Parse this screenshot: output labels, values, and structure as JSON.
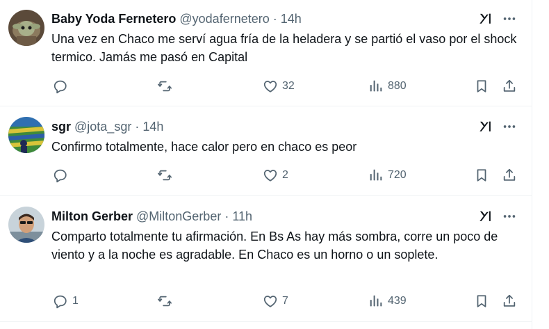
{
  "tweets": [
    {
      "name": "Baby Yoda Fernetero",
      "handle": "@yodafernetero",
      "separator": "·",
      "time": "14h",
      "text": "Una vez en Chaco me serví agua fría de la heladera y se partió el vaso por el shock termico. Jamás me pasó en Capital",
      "replies": "",
      "reposts": "",
      "likes": "32",
      "views": "880"
    },
    {
      "name": "sgr",
      "handle": "@jota_sgr",
      "separator": "·",
      "time": "14h",
      "text": "Confirmo totalmente, hace calor pero en chaco es peor",
      "replies": "",
      "reposts": "",
      "likes": "2",
      "views": "720"
    },
    {
      "name": "Milton Gerber",
      "handle": "@MiltonGerber",
      "separator": "·",
      "time": "11h",
      "text": "Comparto totalmente tu afirmación. En Bs As hay más sombra, corre un poco de viento y a la noche es agradable. En Chaco es un horno o un soplete.",
      "replies": "1",
      "reposts": "",
      "likes": "7",
      "views": "439"
    }
  ],
  "icons": {
    "grok": "grok-icon",
    "more": "more-icon",
    "reply": "reply-icon",
    "repost": "repost-icon",
    "like": "heart-icon",
    "views": "views-icon",
    "bookmark": "bookmark-icon",
    "share": "share-icon"
  },
  "colors": {
    "text_primary": "#0f1419",
    "text_secondary": "#536471",
    "divider": "#eff3f4"
  }
}
